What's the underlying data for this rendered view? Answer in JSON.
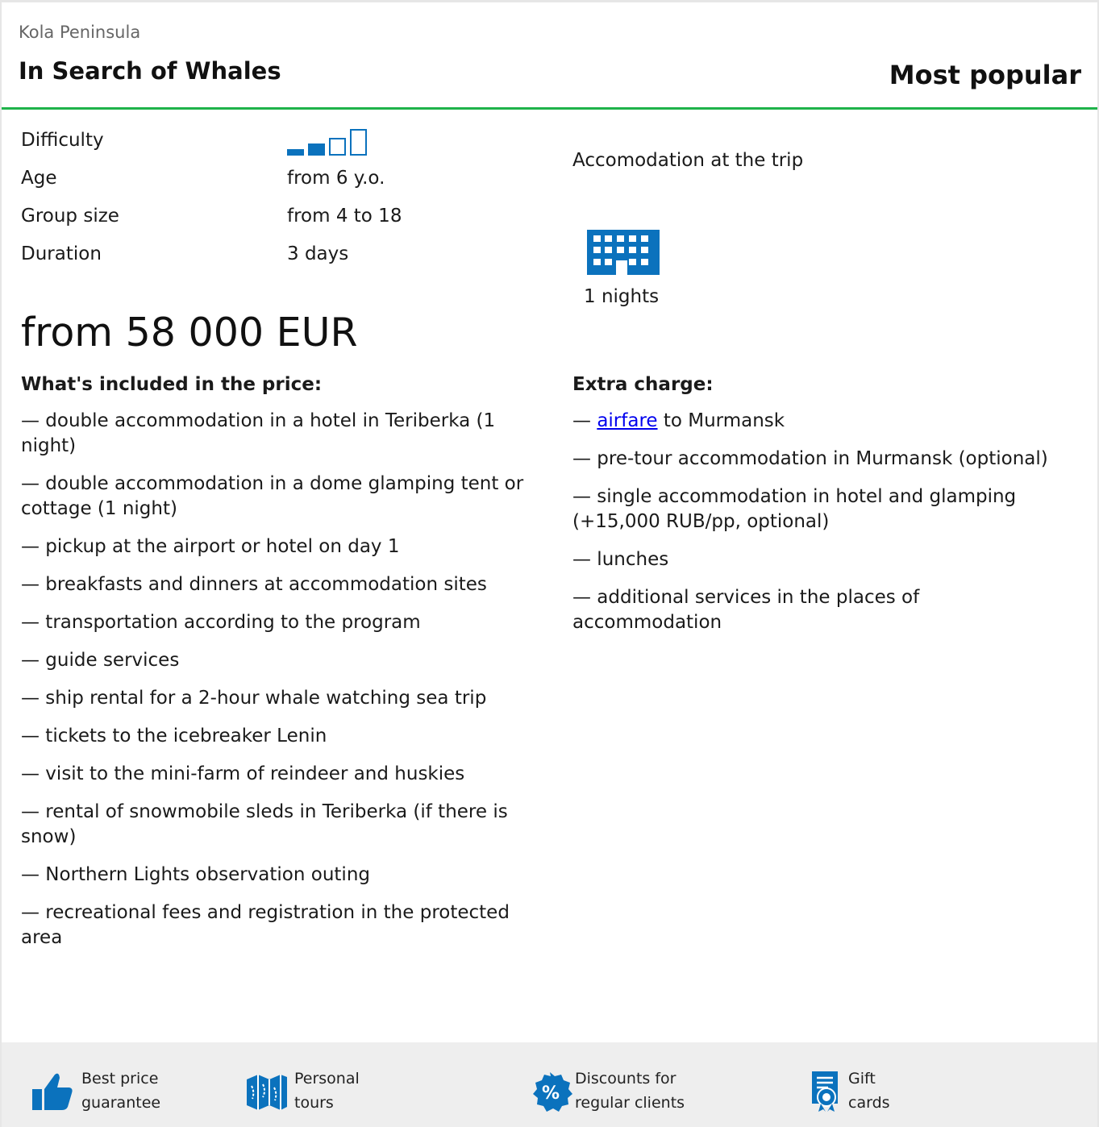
{
  "header": {
    "region": "Kola Peninsula",
    "title": "In Search of Whales",
    "badge": "Most popular"
  },
  "params": {
    "difficulty_label": "Difficulty",
    "difficulty_level": 2,
    "difficulty_max": 4,
    "age_label": "Age",
    "age_value": "from 6 y.o.",
    "group_label": "Group size",
    "group_value": "from 4 to 18",
    "duration_label": "Duration",
    "duration_value": "3 days"
  },
  "price": "from 58 000 EUR",
  "accommodation": {
    "title": "Accomodation at the trip",
    "icon": "hotel-icon",
    "nights": "1 nights"
  },
  "included": {
    "heading": "What's included in the price:",
    "items": [
      "— double accommodation in a hotel in Teriberka (1 night)",
      "— double accommodation in a dome glamping tent or cottage (1 night)",
      "— pickup at the airport or hotel on day 1",
      "— breakfasts and dinners at accommodation sites",
      "— transportation according to the program",
      "— guide services",
      "— ship rental for a 2-hour whale watching sea trip",
      "— tickets to the icebreaker Lenin",
      "— visit to the mini-farm of reindeer and huskies",
      "— rental of snowmobile sleds in Teriberka (if there is snow)",
      "— Northern Lights observation outing",
      "— recreational fees and registration in the protected area"
    ]
  },
  "extra": {
    "heading": "Extra charge:",
    "airfare_prefix": "— ",
    "airfare_link": "airfare",
    "airfare_suffix": " to Murmansk",
    "items": [
      "— pre-tour accommodation in Murmansk (optional)",
      "— single accommodation in hotel and glamping (+15,000 RUB/pp, optional)",
      "— lunches",
      "— additional services in the places of accommodation"
    ]
  },
  "footer": {
    "features": [
      {
        "line1": "Best price",
        "line2": "guarantee",
        "icon": "thumbs-up-icon"
      },
      {
        "line1": "Personal",
        "line2": "tours",
        "icon": "map-icon"
      },
      {
        "line1": "Discounts for",
        "line2": "regular clients",
        "icon": "percent-badge-icon"
      },
      {
        "line1": "Gift",
        "line2": "cards",
        "icon": "certificate-icon"
      }
    ]
  },
  "colors": {
    "accent_blue": "#0b72bd",
    "accent_green": "#1fb34a",
    "footer_bg": "#eeeeee"
  }
}
